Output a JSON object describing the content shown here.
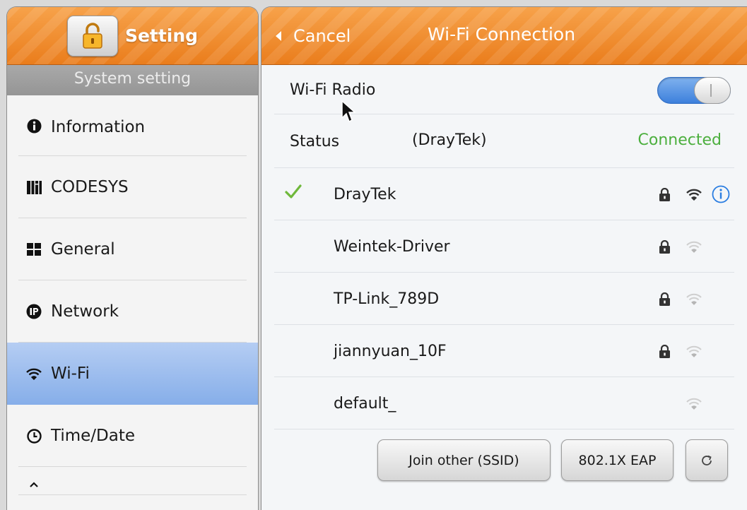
{
  "left": {
    "title": "Setting",
    "section_header": "System setting",
    "items": [
      {
        "label": "Information",
        "icon": "info-icon"
      },
      {
        "label": "CODESYS",
        "icon": "codesys-icon"
      },
      {
        "label": "General",
        "icon": "grid-icon"
      },
      {
        "label": "Network",
        "icon": "ip-icon"
      },
      {
        "label": "Wi-Fi",
        "icon": "wifi-icon",
        "active": true
      },
      {
        "label": "Time/Date",
        "icon": "clock-icon"
      }
    ]
  },
  "right": {
    "cancel_label": "Cancel",
    "title": "Wi-Fi Connection",
    "radio_label": "Wi-Fi Radio",
    "radio_on": true,
    "status_label": "Status",
    "status_ssid": "(DrayTek)",
    "status_value": "Connected",
    "networks": [
      {
        "ssid": "DrayTek",
        "connected": true,
        "secured": true,
        "signal": "strong"
      },
      {
        "ssid": "Weintek-Driver",
        "connected": false,
        "secured": true,
        "signal": "weak"
      },
      {
        "ssid": "TP-Link_789D",
        "connected": false,
        "secured": true,
        "signal": "weak"
      },
      {
        "ssid": "jiannyuan_10F",
        "connected": false,
        "secured": true,
        "signal": "weak"
      },
      {
        "ssid": "default_",
        "connected": false,
        "secured": false,
        "signal": "weak"
      }
    ],
    "buttons": {
      "join_other": "Join other (SSID)",
      "eap": "802.1X EAP"
    }
  },
  "colors": {
    "header_orange": "#ea7d1c",
    "active_blue": "#86aee9",
    "connected_green": "#4caf3e",
    "toggle_blue": "#3d80dc",
    "info_blue": "#2a7de1"
  }
}
